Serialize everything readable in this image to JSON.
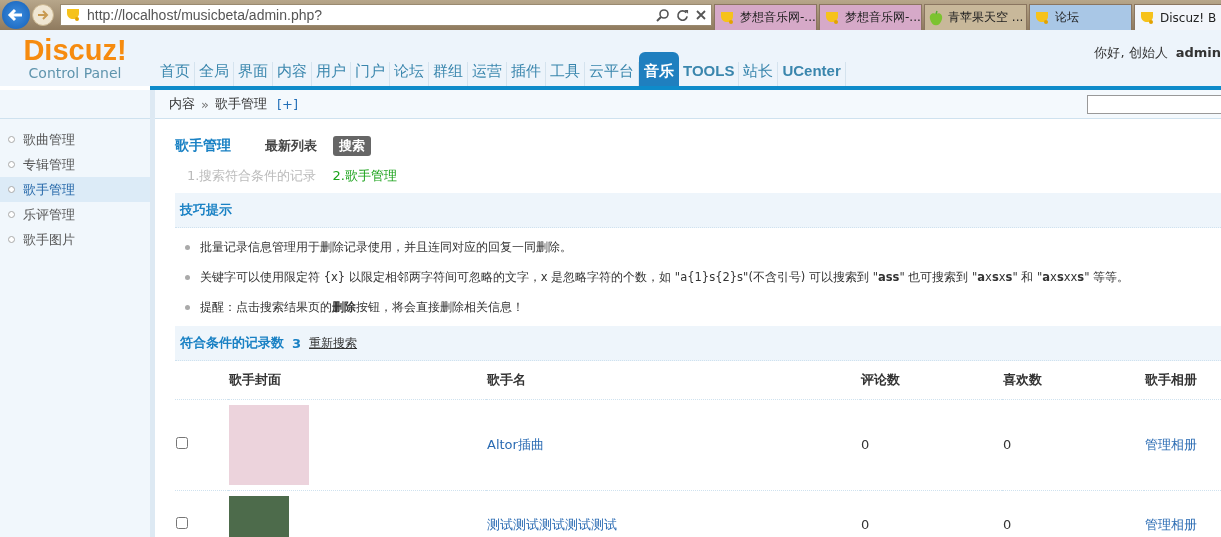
{
  "browser": {
    "address": "http://localhost/musicbeta/admin.php?",
    "tabs": [
      {
        "label": "梦想音乐网-...",
        "selected": false
      },
      {
        "label": "梦想音乐网-...",
        "selected": false
      },
      {
        "label": "青苹果天空 ...",
        "selected": false
      },
      {
        "label": "论坛",
        "selected": false
      },
      {
        "label": "Discuz! B",
        "selected": true
      }
    ]
  },
  "header": {
    "logo": "Discuz!",
    "logo_sub": "Control Panel",
    "nav": [
      {
        "label": "首页",
        "selected": false
      },
      {
        "label": "全局",
        "selected": false
      },
      {
        "label": "界面",
        "selected": false
      },
      {
        "label": "内容",
        "selected": false
      },
      {
        "label": "用户",
        "selected": false
      },
      {
        "label": "门户",
        "selected": false
      },
      {
        "label": "论坛",
        "selected": false
      },
      {
        "label": "群组",
        "selected": false
      },
      {
        "label": "运营",
        "selected": false
      },
      {
        "label": "插件",
        "selected": false
      },
      {
        "label": "工具",
        "selected": false
      },
      {
        "label": "云平台",
        "selected": false
      },
      {
        "label": "音乐",
        "selected": true
      },
      {
        "label": "TOOLS",
        "selected": false
      },
      {
        "label": "站长",
        "selected": false
      },
      {
        "label": "UCenter",
        "selected": false
      }
    ],
    "greeting": "你好, 创始人",
    "user": "admin"
  },
  "breadcrumb": {
    "parent": "内容",
    "separator": "»",
    "current": "歌手管理",
    "add": "[+]"
  },
  "sidebar": {
    "items": [
      {
        "label": "歌曲管理",
        "selected": false
      },
      {
        "label": "专辑管理",
        "selected": false
      },
      {
        "label": "歌手管理",
        "selected": true
      },
      {
        "label": "乐评管理",
        "selected": false
      },
      {
        "label": "歌手图片",
        "selected": false
      }
    ]
  },
  "page": {
    "title": "歌手管理",
    "tabs": [
      {
        "label": "最新列表",
        "selected": false
      },
      {
        "label": "搜索",
        "selected": true
      }
    ],
    "steps": [
      {
        "label": "1.搜索符合条件的记录",
        "selected": false
      },
      {
        "label": "2.歌手管理",
        "selected": true
      }
    ],
    "tips_title": "技巧提示",
    "tips": [
      "批量记录信息管理用于删除记录使用，并且连同对应的回复一同删除。",
      "关键字可以使用限定符 {x} 以限定相邻两字符间可忽略的文字，x 是忽略字符的个数，如 \"a{1}s{2}s\"(不含引号) 可以搜索到 \"**ass**\" 也可搜索到 \"**a**x**s**x**s**\" 和 \"**a**x**s**xx**s**\" 等等。",
      "提醒：点击搜索结果页的**删除**按钮，将会直接删除相关信息！"
    ],
    "result_label": "符合条件的记录数",
    "result_count": "3",
    "research": "重新搜索"
  },
  "table": {
    "columns": [
      "歌手封面",
      "歌手名",
      "评论数",
      "喜欢数",
      "歌手相册"
    ],
    "rows": [
      {
        "checked": false,
        "name": "Altor插曲",
        "comments": "0",
        "likes": "0",
        "album": "管理相册"
      },
      {
        "checked": false,
        "name": "测试测试测试测试测试",
        "comments": "0",
        "likes": "0",
        "album": "管理相册"
      }
    ]
  }
}
